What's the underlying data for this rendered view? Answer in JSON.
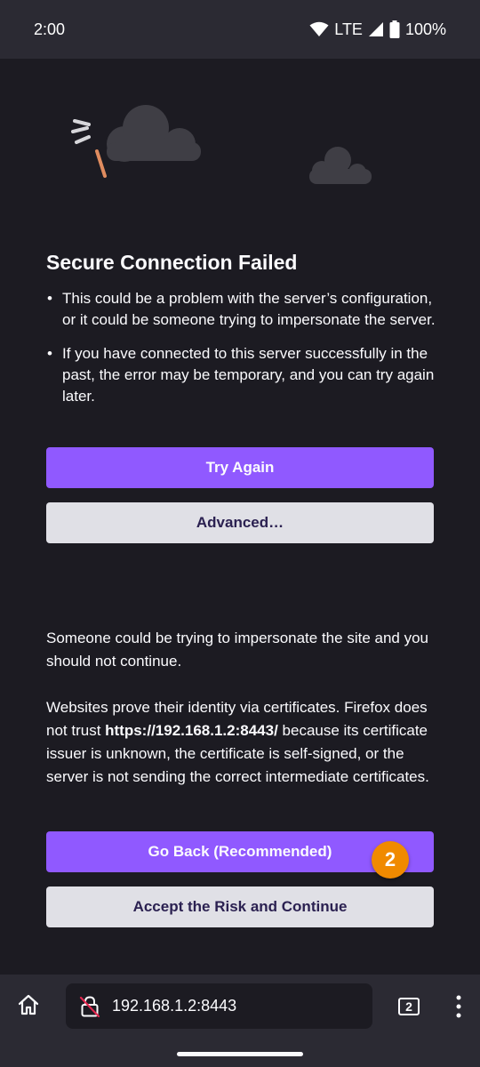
{
  "status_bar": {
    "time": "2:00",
    "network": "LTE",
    "battery": "100%"
  },
  "error_page": {
    "title": "Secure Connection Failed",
    "bullets": [
      "This could be a problem with the server’s configuration, or it could be someone trying to impersonate the server.",
      "If you have connected to this server successfully in the past, the error may be temporary, and you can try again later."
    ],
    "try_again_label": "Try Again",
    "advanced_label": "Advanced…",
    "advanced": {
      "warning_text": "Someone could be trying to impersonate the site and you should not continue.",
      "cert_text_before": "Websites prove their identity via certificates. Firefox does not trust ",
      "cert_host": "https://192.168.1.2:8443/",
      "cert_text_after": " because its certificate issuer is unknown, the certificate is self-signed, or the server is not sending the correct intermediate certificates.",
      "go_back_label": "Go Back (Recommended)",
      "accept_label": "Accept the Risk and Continue"
    },
    "step_badge": "2"
  },
  "toolbar": {
    "url": "192.168.1.2:8443",
    "tab_count": "2"
  },
  "colors": {
    "background": "#1c1b22",
    "chrome": "#2b2a33",
    "primary_button": "#9059ff",
    "secondary_button": "#e0e0e6",
    "badge": "#f08a00"
  },
  "icons": [
    "wifi-icon",
    "signal-icon",
    "battery-icon",
    "cloud-illustration",
    "home-icon",
    "broken-lock-icon",
    "tabs-icon",
    "overflow-menu-icon"
  ]
}
